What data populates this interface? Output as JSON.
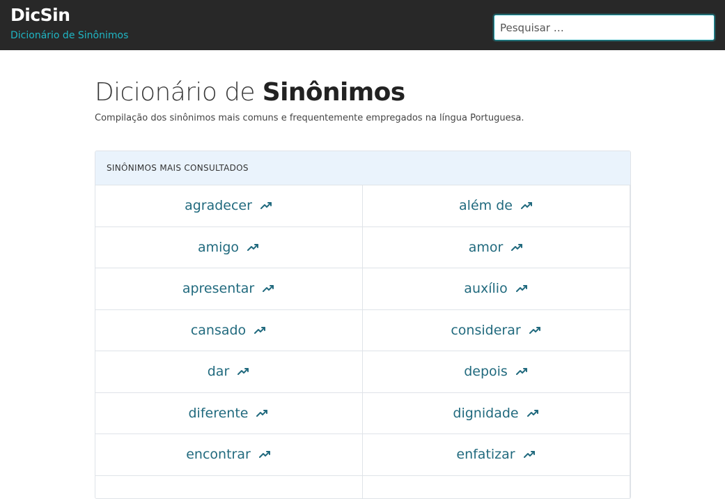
{
  "header": {
    "brand": "DicSin",
    "tagline": "Dicionário de Sinônimos",
    "search_placeholder": "Pesquisar …"
  },
  "intro": {
    "title_light": "Dicionário de",
    "title_bold": "Sinônimos",
    "subtitle": "Compilação dos sinônimos mais comuns e frequentemente empregados na língua Portuguesa."
  },
  "panel": {
    "heading": "SINÔNIMOS MAIS CONSULTADOS",
    "items": [
      {
        "word": "agradecer"
      },
      {
        "word": "além de"
      },
      {
        "word": "amigo"
      },
      {
        "word": "amor"
      },
      {
        "word": "apresentar"
      },
      {
        "word": "auxílio"
      },
      {
        "word": "cansado"
      },
      {
        "word": "considerar"
      },
      {
        "word": "dar"
      },
      {
        "word": "depois"
      },
      {
        "word": "diferente"
      },
      {
        "word": "dignidade"
      },
      {
        "word": "encontrar"
      },
      {
        "word": "enfatizar"
      },
      {
        "word": ""
      },
      {
        "word": ""
      }
    ],
    "item_icon": "trending-up-icon"
  },
  "colors": {
    "topbar": "#282828",
    "accent": "#1fb6c4",
    "link": "#216a7e",
    "panel_header_bg": "#eaf3fc"
  }
}
